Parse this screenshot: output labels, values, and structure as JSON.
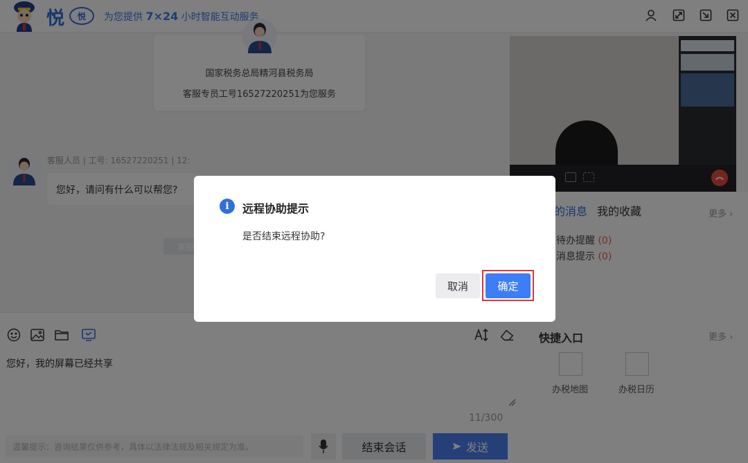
{
  "header": {
    "logo_text": "悦",
    "logo_badge": "悦",
    "tagline_prefix": "为您提供",
    "tagline_highlight": "7×24",
    "tagline_suffix": "小时智能互动服务"
  },
  "chat": {
    "agent_org": "国家税务总局精河县税务局",
    "agent_intro": "客服专员工号16527220251为您服务",
    "message_meta": "客服人员 | 工号: 16527220251 | 12:",
    "message_text": "您好，请问有什么可以帮您?",
    "system_tip": "客服"
  },
  "right_panel": {
    "tab_messages": "的消息",
    "tab_favorites": "我的收藏",
    "more_label": "更多",
    "todo_label": "待办提醒",
    "todo_count": "(0)",
    "msg_tip_label": "消息提示",
    "msg_tip_count": "(0)",
    "quick_title": "快捷入口",
    "quick_more": "更多",
    "quick_items": [
      {
        "label": "办税地图"
      },
      {
        "label": "办税日历"
      }
    ]
  },
  "composer": {
    "input_value": "您好，我的屏幕已经共享",
    "counter": "11/300",
    "hint": "温馨提示：咨询结果仅供参考，具体以法律法规及相关规定为准。",
    "end_label": "结束会话",
    "send_label": "发送"
  },
  "dialog": {
    "title": "远程协助提示",
    "message": "是否结束远程协助?",
    "cancel_label": "取消",
    "confirm_label": "确定"
  },
  "colors": {
    "brand_blue": "#2f6fe0",
    "send_blue": "#4a7ff0",
    "alert_red": "#e65c4f",
    "hangup_red": "#e84c3d"
  }
}
